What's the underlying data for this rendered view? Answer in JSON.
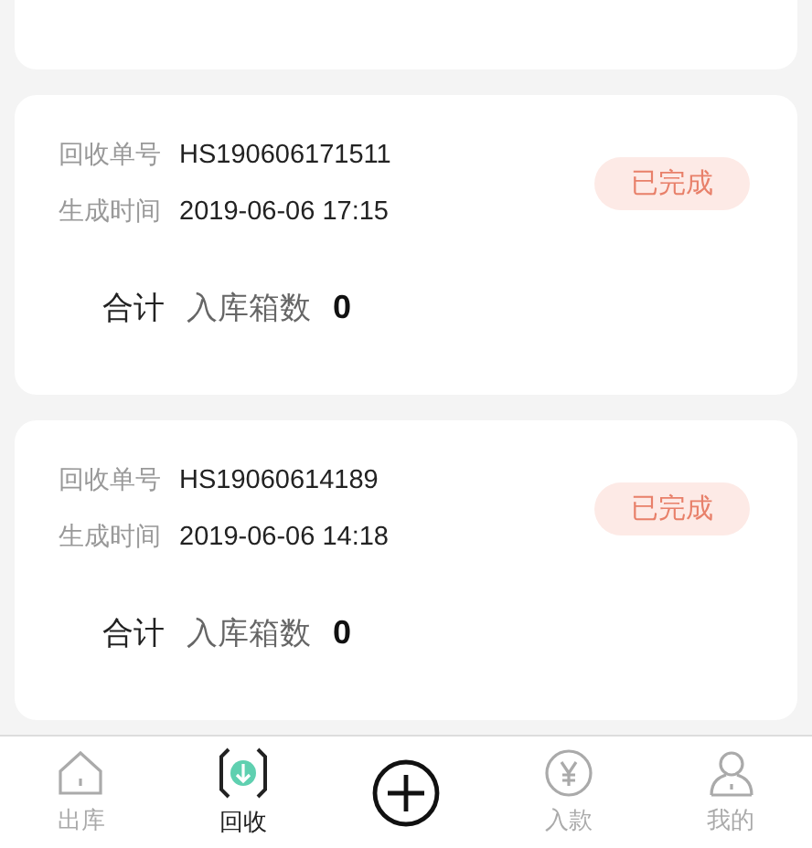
{
  "records": [
    {
      "number_label": "回收单号",
      "number": "HS190606171511",
      "time_label": "生成时间",
      "time": "2019-06-06 17:15",
      "status": "已完成",
      "total_label": "合计",
      "count_label": "入库箱数",
      "count": "0"
    },
    {
      "number_label": "回收单号",
      "number": "HS19060614189",
      "time_label": "生成时间",
      "time": "2019-06-06 14:18",
      "status": "已完成",
      "total_label": "合计",
      "count_label": "入库箱数",
      "count": "0"
    }
  ],
  "tab_bar": [
    {
      "kind": "house",
      "label": "出库",
      "selected": false
    },
    {
      "kind": "download",
      "label": "回收",
      "selected": true
    },
    {
      "kind": "add"
    },
    {
      "kind": "yen",
      "label": "入款",
      "selected": false
    },
    {
      "kind": "person",
      "label": "我的",
      "selected": false
    }
  ]
}
